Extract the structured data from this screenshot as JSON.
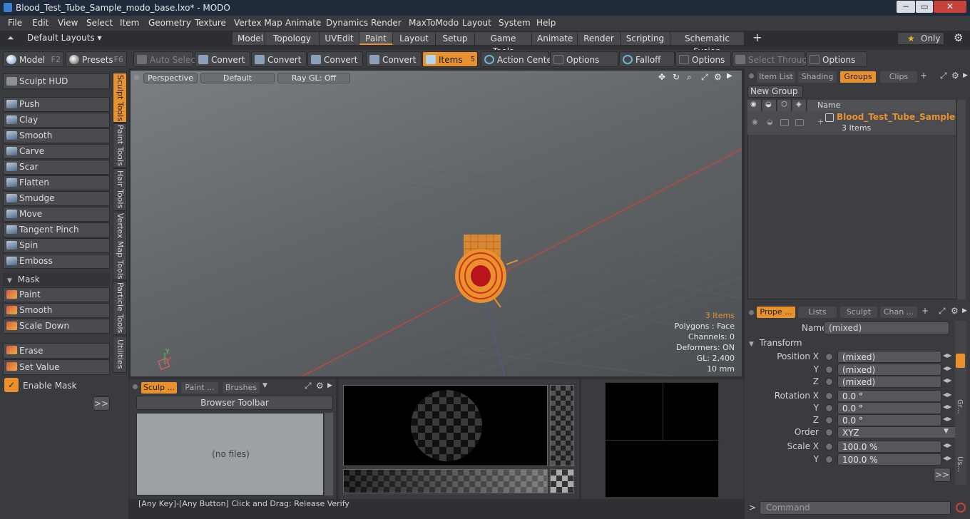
{
  "window": {
    "title": "Blood_Test_Tube_Sample_modo_base.lxo* - MODO",
    "min": "−",
    "max": "▭",
    "close": "✕"
  },
  "menu": [
    "File",
    "Edit",
    "View",
    "Select",
    "Item",
    "Geometry",
    "Texture",
    "Vertex Map",
    "Animate",
    "Dynamics",
    "Render",
    "MaxToModo",
    "Layout",
    "System",
    "Help"
  ],
  "layouts": {
    "label": "Default Layouts ▾",
    "tabs": [
      "Model",
      "Topology",
      "UVEdit",
      "Paint",
      "Layout",
      "Setup",
      "Game Tools",
      "Animate",
      "Render",
      "Scripting",
      "Schematic Fusion"
    ],
    "active": "Paint",
    "plus": "+",
    "only": "Only",
    "star": "★",
    "gear": "⚙"
  },
  "toolbar": {
    "model": "Model",
    "model_key": "F2",
    "presets": "Presets",
    "presets_key": "F6",
    "auto_select": "Auto Select",
    "convert1": "Convert",
    "convert2": "Convert",
    "convert3": "Convert",
    "convert4": "Convert",
    "items": "Items",
    "items_badge": "5",
    "action_center": "Action Center",
    "options1": "Options",
    "falloff": "Falloff",
    "options2": "Options",
    "select_through": "Select Through",
    "options3": "Options"
  },
  "left": {
    "sculpt_hud": "Sculpt HUD",
    "tools": [
      "Push",
      "Clay",
      "Smooth",
      "Carve",
      "Scar",
      "Flatten",
      "Smudge",
      "Move",
      "Tangent Pinch",
      "Spin",
      "Emboss"
    ],
    "mask_header": "Mask",
    "mask_tools": [
      "Paint",
      "Smooth",
      "Scale Down"
    ],
    "erase": "Erase",
    "set_value": "Set Value",
    "enable_mask": "Enable Mask",
    "more": ">>"
  },
  "vtabs": [
    "Sculpt Tools",
    "Paint Tools",
    "Hair Tools",
    "Vertex Map Tools",
    "Particle Tools",
    "Utilities"
  ],
  "viewport": {
    "perspective": "Perspective",
    "default": "Default",
    "raygl": "Ray GL: Off",
    "stats": {
      "items": "3 Items",
      "polygons": "Polygons : Face",
      "channels": "Channels: 0",
      "deformers": "Deformers: ON",
      "gl": "GL: 2,400",
      "scale": "10 mm"
    },
    "axis_y": "Y",
    "accent": "#e8912d"
  },
  "bottom": {
    "tabs": [
      "Sculp ...",
      "Paint ...",
      "Brushes"
    ],
    "browser_toolbar": "Browser Toolbar",
    "no_files": "(no files)"
  },
  "status": "[Any Key]-[Any Button] Click and Drag:  Release Verify",
  "command_placeholder": "Command",
  "groups": {
    "tabs": [
      "Item List",
      "Shading",
      "Groups",
      "Clips"
    ],
    "active": "Groups",
    "new_group": "New Group",
    "col_name": "Name",
    "group_name": "Blood_Test_Tube_Sample",
    "group_count": "3 Items"
  },
  "props": {
    "tabs": [
      "Prope ...",
      "Lists",
      "Sculpt",
      "Chan ..."
    ],
    "name_label": "Name",
    "name_value": "(mixed)",
    "transform": "Transform",
    "rows": [
      {
        "label": "Position X",
        "value": "(mixed)"
      },
      {
        "label": "Y",
        "value": "(mixed)"
      },
      {
        "label": "Z",
        "value": "(mixed)"
      },
      {
        "label": "Rotation X",
        "value": "0.0 °"
      },
      {
        "label": "Y",
        "value": "0.0 °"
      },
      {
        "label": "Z",
        "value": "0.0 °"
      },
      {
        "label": "Order",
        "value": "XYZ"
      },
      {
        "label": "Scale X",
        "value": "100.0 %"
      },
      {
        "label": "Y",
        "value": "100.0 %"
      }
    ],
    "more": ">>",
    "side1": "Gr...",
    "side2": "Us..."
  }
}
